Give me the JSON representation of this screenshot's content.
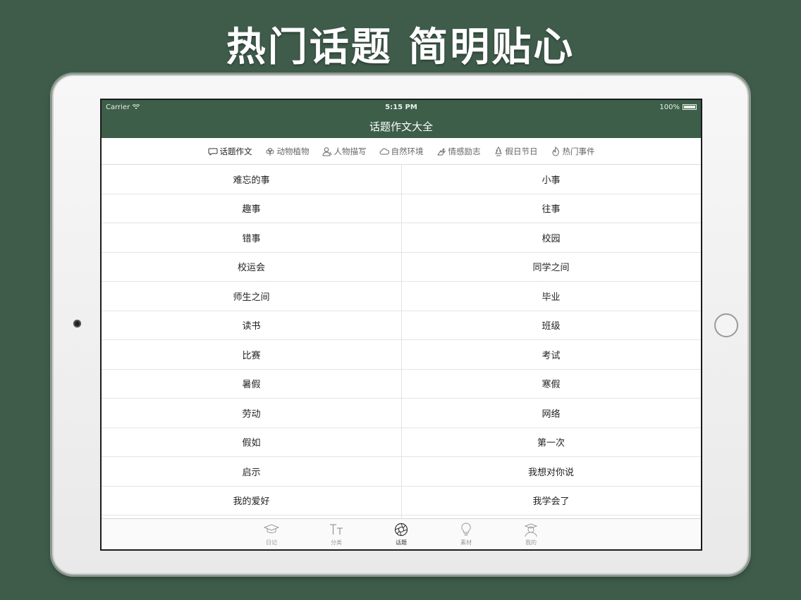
{
  "headline": "热门话题 简明贴心",
  "status": {
    "carrier": "Carrier",
    "time": "5:15 PM",
    "battery": "100%"
  },
  "nav": {
    "title": "话题作文大全"
  },
  "categories": [
    {
      "label": "话题作文",
      "icon": "speech-bubble-icon"
    },
    {
      "label": "动物植物",
      "icon": "flower-icon"
    },
    {
      "label": "人物描写",
      "icon": "person-icon"
    },
    {
      "label": "自然环境",
      "icon": "cloud-icon"
    },
    {
      "label": "情感励志",
      "icon": "hand-icon"
    },
    {
      "label": "假日节日",
      "icon": "tree-icon"
    },
    {
      "label": "热门事件",
      "icon": "flame-icon"
    }
  ],
  "topics": [
    [
      "难忘的事",
      "小事"
    ],
    [
      "趣事",
      "往事"
    ],
    [
      "错事",
      "校园"
    ],
    [
      "校运会",
      "同学之间"
    ],
    [
      "师生之间",
      "毕业"
    ],
    [
      "读书",
      "班级"
    ],
    [
      "比赛",
      "考试"
    ],
    [
      "暑假",
      "寒假"
    ],
    [
      "劳动",
      "网络"
    ],
    [
      "假如",
      "第一次"
    ],
    [
      "启示",
      "我想对你说"
    ],
    [
      "我的爱好",
      "我学会了"
    ]
  ],
  "tabbar": [
    {
      "label": "日记",
      "icon": "graduation-cap-icon"
    },
    {
      "label": "分类",
      "icon": "text-size-icon"
    },
    {
      "label": "话题",
      "icon": "aperture-icon"
    },
    {
      "label": "素材",
      "icon": "lightbulb-icon"
    },
    {
      "label": "我的",
      "icon": "user-cap-icon"
    }
  ],
  "colors": {
    "background": "#3f5c4b",
    "bar": "#3d5f4a"
  }
}
